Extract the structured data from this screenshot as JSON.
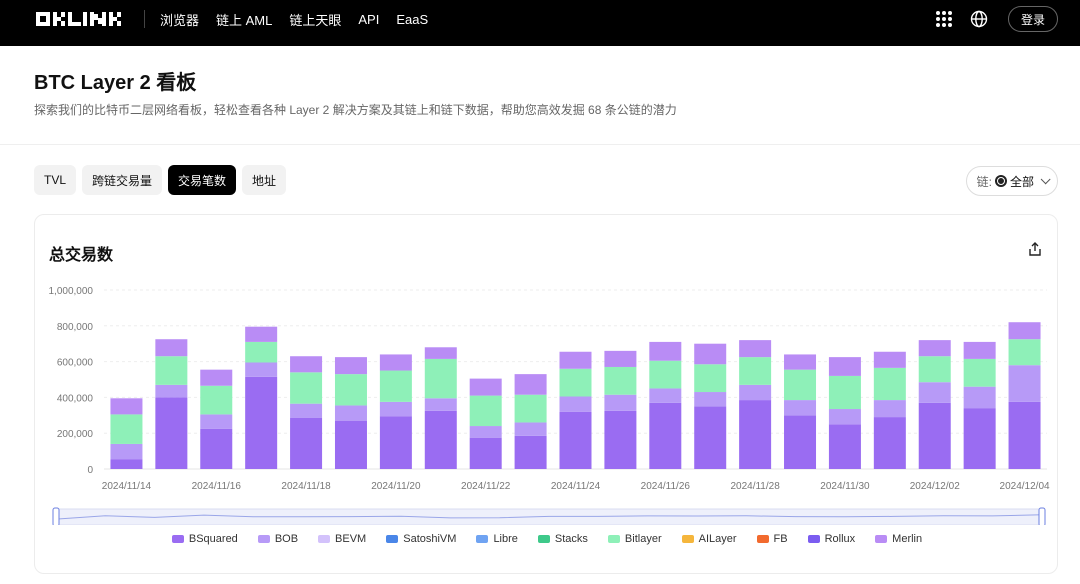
{
  "nav": {
    "logo_text": "OKLINK",
    "links": [
      "浏览器",
      "链上 AML",
      "链上天眼",
      "API",
      "EaaS"
    ],
    "login_label": "登录"
  },
  "header": {
    "title": "BTC Layer 2 看板",
    "subtitle": "探索我们的比特币二层网络看板，轻松查看各种 Layer 2 解决方案及其链上和链下数据，帮助您高效发掘 68 条公链的潜力"
  },
  "tabs": [
    {
      "label": "TVL",
      "active": false
    },
    {
      "label": "跨链交易量",
      "active": false
    },
    {
      "label": "交易笔数",
      "active": true
    },
    {
      "label": "地址",
      "active": false
    }
  ],
  "chain_filter": {
    "label": "链:",
    "value": "全部"
  },
  "card": {
    "title": "总交易数"
  },
  "colors": {
    "BSquared": "#9a6cf2",
    "BOB": "#b79af7",
    "BEVM": "#d3c2fb",
    "SatoshiVM": "#4a86e8",
    "Libre": "#6fa3f2",
    "Stacks": "#3ec98a",
    "Bitlayer": "#8ef0b8",
    "AILayer": "#f5b63c",
    "FB": "#f26a2e",
    "Rollux": "#7b5cf0",
    "Merlin": "#b98cf5"
  },
  "chart_data": {
    "type": "bar",
    "stacked": true,
    "title": "总交易数",
    "y_ticks": [
      "1,000,000",
      "800,000",
      "600,000",
      "400,000",
      "200,000",
      "0"
    ],
    "ylim": [
      0,
      1000000
    ],
    "x_tick_labels": [
      "2024/11/14",
      "2024/11/16",
      "2024/11/18",
      "2024/11/20",
      "2024/11/22",
      "2024/11/24",
      "2024/11/26",
      "2024/11/28",
      "2024/11/30",
      "2024/12/02",
      "2024/12/04"
    ],
    "categories": [
      "2024/11/14",
      "2024/11/15",
      "2024/11/16",
      "2024/11/17",
      "2024/11/18",
      "2024/11/19",
      "2024/11/20",
      "2024/11/21",
      "2024/11/22",
      "2024/11/23",
      "2024/11/24",
      "2024/11/25",
      "2024/11/26",
      "2024/11/27",
      "2024/11/28",
      "2024/11/29",
      "2024/11/30",
      "2024/12/01",
      "2024/12/02",
      "2024/12/03",
      "2024/12/04"
    ],
    "legend": [
      "BSquared",
      "BOB",
      "BEVM",
      "SatoshiVM",
      "Libre",
      "Stacks",
      "Bitlayer",
      "AILayer",
      "FB",
      "Rollux",
      "Merlin"
    ],
    "series": [
      {
        "name": "BSquared",
        "values": [
          55000,
          400000,
          225000,
          515000,
          285000,
          270000,
          295000,
          325000,
          175000,
          185000,
          320000,
          325000,
          370000,
          350000,
          385000,
          300000,
          250000,
          290000,
          370000,
          340000,
          375000
        ]
      },
      {
        "name": "BOB",
        "values": [
          85000,
          70000,
          80000,
          80000,
          80000,
          85000,
          80000,
          70000,
          65000,
          75000,
          85000,
          90000,
          80000,
          80000,
          85000,
          85000,
          85000,
          95000,
          115000,
          120000,
          205000
        ]
      },
      {
        "name": "Bitlayer",
        "values": [
          165000,
          160000,
          160000,
          115000,
          175000,
          175000,
          175000,
          220000,
          170000,
          155000,
          155000,
          155000,
          155000,
          155000,
          155000,
          170000,
          185000,
          180000,
          145000,
          155000,
          145000
        ]
      },
      {
        "name": "Merlin",
        "values": [
          90000,
          95000,
          90000,
          85000,
          90000,
          95000,
          90000,
          65000,
          95000,
          115000,
          95000,
          90000,
          105000,
          115000,
          95000,
          85000,
          105000,
          90000,
          90000,
          95000,
          95000
        ]
      }
    ],
    "zoom_range": [
      0,
      1
    ]
  }
}
